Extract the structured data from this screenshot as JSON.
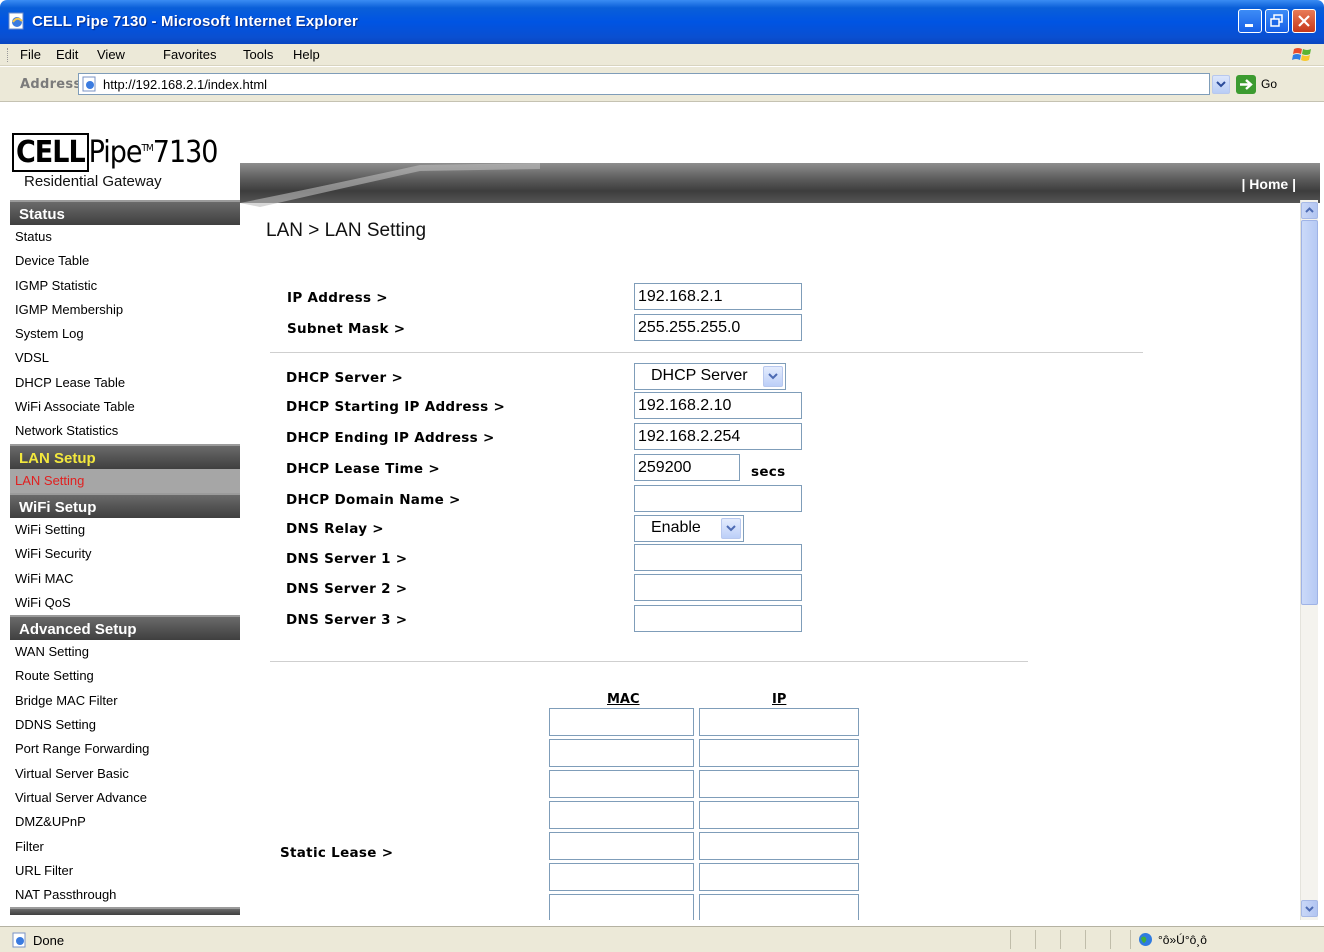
{
  "window": {
    "title": "CELL Pipe 7130 - Microsoft Internet Explorer"
  },
  "menu": [
    "File",
    "Edit",
    "View",
    "Favorites",
    "Tools",
    "Help"
  ],
  "address": {
    "label": "Address",
    "url": "http://192.168.2.1/index.html",
    "go_label": "Go"
  },
  "branding": {
    "brand_bold": "CELL",
    "brand_rest": "Pipe",
    "tm": "TM",
    "model": "7130",
    "subtitle": "Residential Gateway"
  },
  "banner": {
    "home_link": "| Home |"
  },
  "sidebar": {
    "sections": [
      {
        "title": "Status",
        "active": false,
        "items": [
          "Status",
          "Device Table",
          "IGMP Statistic",
          "IGMP Membership",
          "System Log",
          "VDSL",
          "DHCP Lease Table",
          "WiFi Associate Table",
          "Network Statistics"
        ]
      },
      {
        "title": "LAN Setup",
        "active": true,
        "items": [
          "LAN Setting"
        ],
        "selected": "LAN Setting"
      },
      {
        "title": "WiFi Setup",
        "active": false,
        "items": [
          "WiFi Setting",
          "WiFi Security",
          "WiFi MAC",
          "WiFi QoS"
        ]
      },
      {
        "title": "Advanced Setup",
        "active": false,
        "items": [
          "WAN Setting",
          "Route Setting",
          "Bridge MAC Filter",
          "DDNS Setting",
          "Port Range Forwarding",
          "Virtual Server Basic",
          "Virtual Server Advance",
          "DMZ&UPnP",
          "Filter",
          "URL Filter",
          "NAT Passthrough"
        ]
      }
    ]
  },
  "content": {
    "breadcrumb": "LAN > LAN Setting",
    "ip_address": {
      "label": "IP Address >",
      "value": "192.168.2.1"
    },
    "subnet_mask": {
      "label": "Subnet Mask >",
      "value": "255.255.255.0"
    },
    "dhcp_server": {
      "label": "DHCP Server >",
      "value": "DHCP Server"
    },
    "dhcp_start": {
      "label": "DHCP Starting IP Address >",
      "value": "192.168.2.10"
    },
    "dhcp_end": {
      "label": "DHCP Ending IP Address >",
      "value": "192.168.2.254"
    },
    "dhcp_lease": {
      "label": "DHCP Lease Time >",
      "value": "259200",
      "unit": "secs"
    },
    "dhcp_domain": {
      "label": "DHCP Domain Name >",
      "value": ""
    },
    "dns_relay": {
      "label": "DNS Relay >",
      "value": "Enable"
    },
    "dns1": {
      "label": "DNS Server 1 >",
      "value": ""
    },
    "dns2": {
      "label": "DNS Server 2 >",
      "value": ""
    },
    "dns3": {
      "label": "DNS Server 3 >",
      "value": ""
    },
    "static_lease": {
      "label": "Static Lease >",
      "mac_header": "MAC",
      "ip_header": "IP",
      "rows_visible": 7
    }
  },
  "status": {
    "text": "Done",
    "zone": "°ô»Ú°ô¸ô"
  },
  "colors": {
    "title_blue": "#0054e3",
    "chrome": "#ece9d8",
    "section_header": "#4a4a4a",
    "active_section_text": "#f3e83d",
    "selected_item_text": "#e02020"
  }
}
